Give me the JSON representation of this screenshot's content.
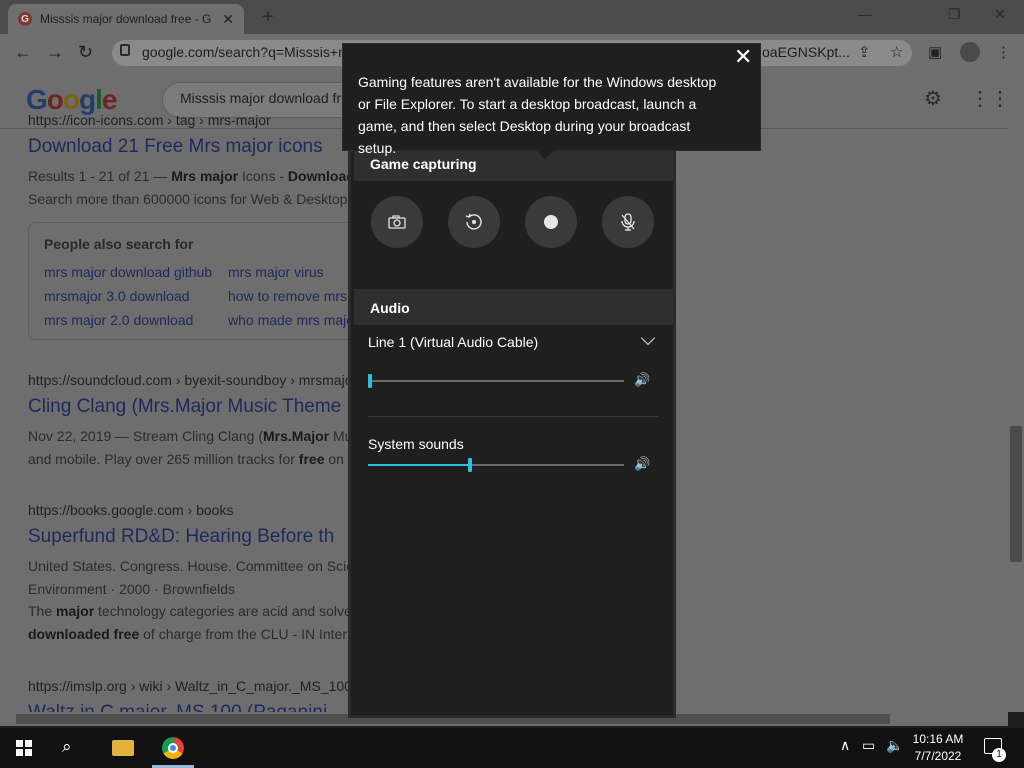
{
  "browser": {
    "tab_title": "Misssis major download free - G",
    "tab_close": "✕",
    "new_tab": "+",
    "url": "google.com/search?q=Misssis+m",
    "url_tail": "oaEGNSKpt..."
  },
  "google": {
    "logo": [
      "G",
      "o",
      "o",
      "g",
      "l",
      "e"
    ],
    "query": "Misssis major download fr"
  },
  "results": [
    {
      "cite": "https://icon-icons.com › tag › mrs-major",
      "title": "Download 21 Free Mrs major icons",
      "snippet_1": "Results 1 - 21 of 21 — Mrs major Icons - Download",
      "snippet_2": "Search more than 600000 icons for Web & Desktop"
    },
    {
      "cite": "https://soundcloud.com › byexit-soundboy › mrsmajo",
      "title": "Cling Clang (Mrs.Major Music Theme",
      "snippet_1": "Nov 22, 2019 — Stream Cling Clang (Mrs.Major Mu",
      "snippet_2": "and mobile. Play over 265 million tracks for free on S"
    },
    {
      "cite": "https://books.google.com › books",
      "title": "Superfund RD&D: Hearing Before th",
      "snippet_1": "United States. Congress. House. Committee on Scie",
      "snippet_2": "Environment · 2000 · Brownfields",
      "snippet_3": "The major technology categories are acid and solve",
      "snippet_4": "downloaded free of charge from the CLU - IN Intern"
    },
    {
      "cite": "https://imslp.org › wiki › Waltz_in_C_major._MS_100",
      "title": "Waltz in C major, MS.100 (Paganini"
    }
  ],
  "people_also_search": {
    "title": "People also search for",
    "items": [
      "mrs major download github",
      "mrs major virus",
      "mrsmajor 3.0 download",
      "how to remove mrs",
      "mrs major 2.0 download",
      "who made mrs majo"
    ]
  },
  "tooltip": {
    "text": "Gaming features aren't available for the Windows desktop or File Explorer. To start a desktop broadcast, launch a game, and then select Desktop during your broadcast setup.",
    "close": "✕"
  },
  "gamebar": {
    "capture_header": "Game capturing",
    "audio_header": "Audio",
    "device_name": "Line 1 (Virtual Audio Cable)",
    "device_volume": 0.0,
    "system_label": "System sounds",
    "system_volume": 0.39,
    "speaker_glyph": "🔊"
  },
  "taskbar": {
    "time": "10:16 AM",
    "date": "7/7/2022",
    "notifications": "1"
  },
  "colors": {
    "accent": "#27c2d6",
    "panel": "#1f1f1f",
    "header": "#2f2f2f"
  },
  "icons": [
    "camera-icon",
    "replay-icon",
    "record-icon",
    "mic-off-icon",
    "speaker-icon",
    "chevron-down-icon",
    "close-icon"
  ]
}
